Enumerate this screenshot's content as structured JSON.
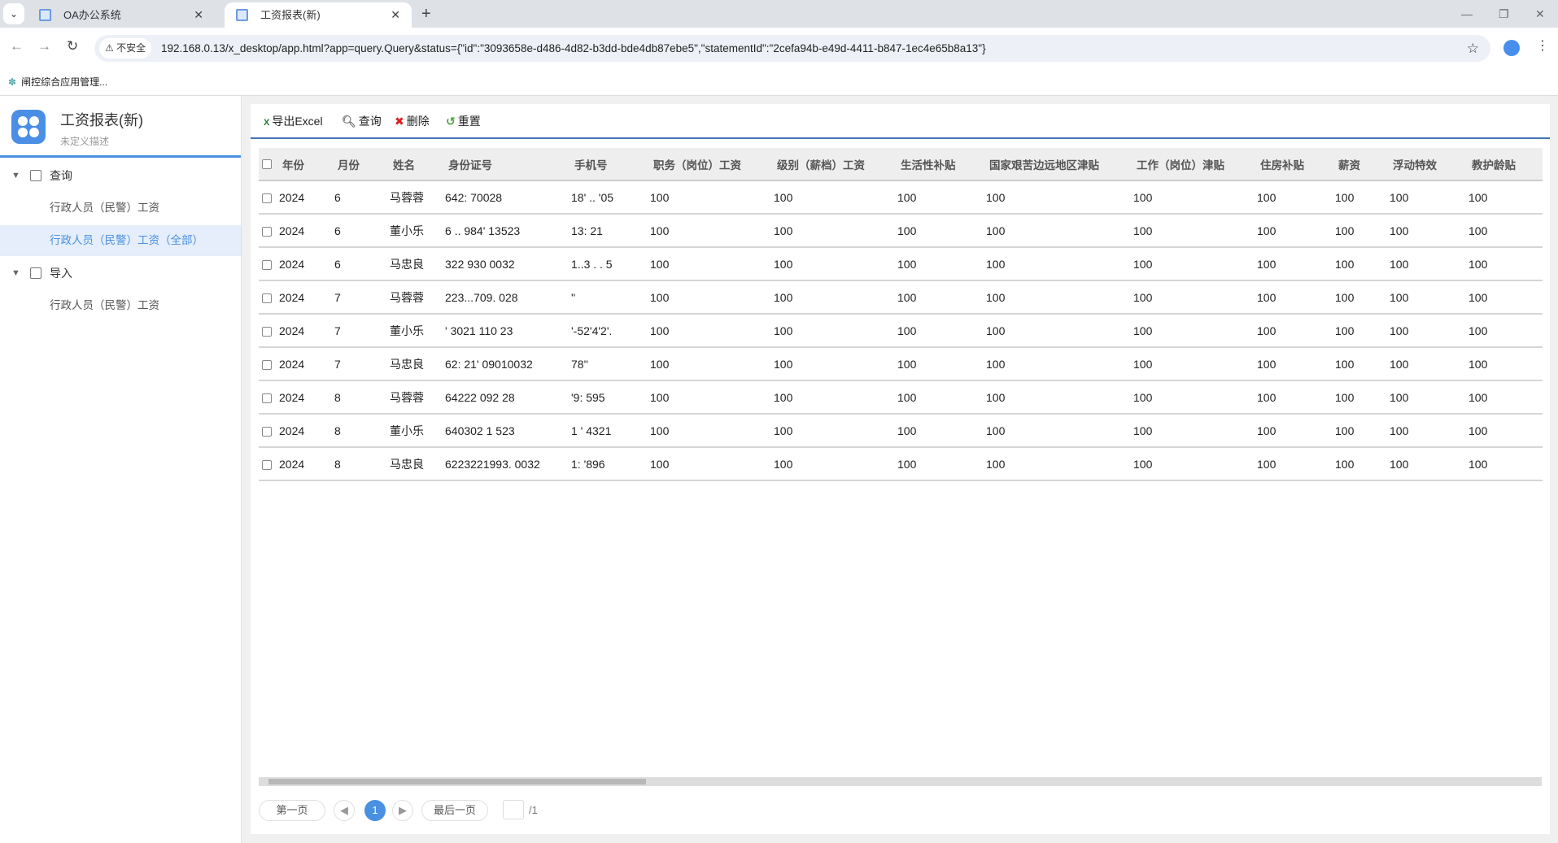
{
  "browser": {
    "tabs": [
      {
        "label": "OA办公系统"
      },
      {
        "label": "工资报表(新)"
      }
    ],
    "security_label": "不安全",
    "url": "192.168.0.13/x_desktop/app.html?app=query.Query&status={\"id\":\"3093658e-d486-4d82-b3dd-bde4db87ebe5\",\"statementId\":\"2cefa94b-e49d-4411-b847-1ec4e65b8a13\"}",
    "bookmark": "闸控综合应用管理..."
  },
  "app": {
    "title": "工资报表(新)",
    "description": "未定义描述"
  },
  "tree": {
    "query": {
      "label": "查询",
      "items": [
        "行政人员（民警）工资",
        "行政人员（民警）工资（全部）"
      ]
    },
    "import": {
      "label": "导入",
      "items": [
        "行政人员（民警）工资"
      ]
    }
  },
  "toolbar": {
    "export": "导出Excel",
    "query": "查询",
    "delete": "删除",
    "reset": "重置"
  },
  "table": {
    "headers": [
      "年份",
      "月份",
      "姓名",
      "身份证号",
      "手机号",
      "职务（岗位）工资",
      "级别（薪档）工资",
      "生活性补贴",
      "国家艰苦边远地区津贴",
      "工作（岗位）津贴",
      "住房补贴",
      "薪资",
      "浮动特效",
      "教护龄贴"
    ],
    "rows": [
      [
        "2024",
        "6",
        "马蓉蓉",
        "642:      70028",
        "18'  ..  '05",
        "100",
        "100",
        "100",
        "100",
        "100",
        "100",
        "100",
        "100",
        "100"
      ],
      [
        "2024",
        "6",
        "董小乐",
        "6  ..  984'  13523",
        "13:      21",
        "100",
        "100",
        "100",
        "100",
        "100",
        "100",
        "100",
        "100",
        "100"
      ],
      [
        "2024",
        "6",
        "马忠良",
        "   322  930  0032",
        "1..3  . .  5",
        "100",
        "100",
        "100",
        "100",
        "100",
        "100",
        "100",
        "100",
        "100"
      ],
      [
        "2024",
        "7",
        "马蓉蓉",
        "  223...709.  028",
        "  ''",
        "100",
        "100",
        "100",
        "100",
        "100",
        "100",
        "100",
        "100",
        "100"
      ],
      [
        "2024",
        "7",
        "董小乐",
        " '  3021  110  23",
        "'-52'4'2'.",
        "100",
        "100",
        "100",
        "100",
        "100",
        "100",
        "100",
        "100",
        "100"
      ],
      [
        "2024",
        "7",
        "马忠良",
        "62:  21'  09010032",
        "    78''",
        "100",
        "100",
        "100",
        "100",
        "100",
        "100",
        "100",
        "100",
        "100"
      ],
      [
        "2024",
        "8",
        "马蓉蓉",
        "64222    092  28",
        "'9:   595",
        "100",
        "100",
        "100",
        "100",
        "100",
        "100",
        "100",
        "100",
        "100"
      ],
      [
        "2024",
        "8",
        "董小乐",
        "640302   1  523",
        "1    '  4321",
        "100",
        "100",
        "100",
        "100",
        "100",
        "100",
        "100",
        "100",
        "100"
      ],
      [
        "2024",
        "8",
        "马忠良",
        "6223221993.  0032",
        "1:   '896",
        "100",
        "100",
        "100",
        "100",
        "100",
        "100",
        "100",
        "100",
        "100"
      ]
    ]
  },
  "pager": {
    "first": "第一页",
    "current": "1",
    "last": "最后一页",
    "total": "/1"
  }
}
